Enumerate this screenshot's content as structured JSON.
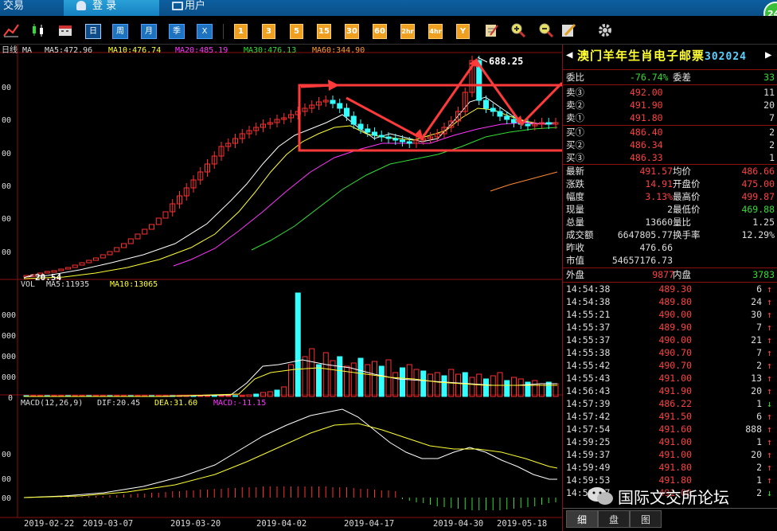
{
  "tabs": [
    {
      "label": "交易"
    },
    {
      "label": "登 录"
    },
    {
      "label": "用户"
    }
  ],
  "badge": "24",
  "toolbar": {
    "periods": [
      "日",
      "周",
      "月",
      "季",
      "X"
    ],
    "minutes": [
      "1",
      "3",
      "5",
      "15",
      "30",
      "60",
      "2hr",
      "4hr",
      "Y"
    ]
  },
  "chart": {
    "ma_label": "MA",
    "period_label": "日线",
    "ma5": "MA5:472.96",
    "ma10": "MA10:476.74",
    "ma20": "MA20:485.19",
    "ma30": "MA30:476.13",
    "ma60": "MA60:344.90",
    "high_label": "688.25",
    "low_label": "20.54",
    "vol_label": "VOL",
    "vol_ma5": "MA5:11935",
    "vol_ma10": "MA10:13065",
    "macd_label": "MACD(12,26,9)",
    "dif": "DIF:20.45",
    "dea": "DEA:31.60",
    "macd": "MACD:-11.15",
    "y_ticks_price": [
      "00",
      "00",
      "00",
      "00",
      "00",
      "00",
      "00"
    ],
    "y_ticks_vol": [
      "000",
      "000",
      "000",
      "000",
      "0"
    ],
    "y_ticks_macd": [
      "00",
      "00",
      "00"
    ],
    "dates": [
      "2019-02-22",
      "2019-03-07",
      "2019-03-20",
      "2019-04-02",
      "2019-04-17",
      "2019-04-30",
      "2019-05-18"
    ]
  },
  "quote": {
    "name": "澳门羊年生肖电子邮票",
    "code": "302024",
    "weibi_label": "委比",
    "weibi_value": "-76.74%",
    "weicha_label": "委差",
    "weicha_value": "33",
    "asks": [
      {
        "label": "卖③",
        "price": "492.00",
        "vol": "11"
      },
      {
        "label": "卖②",
        "price": "491.90",
        "vol": "20"
      },
      {
        "label": "卖①",
        "price": "491.80",
        "vol": "7"
      }
    ],
    "bids": [
      {
        "label": "买①",
        "price": "486.40",
        "vol": "2"
      },
      {
        "label": "买②",
        "price": "486.34",
        "vol": "2"
      },
      {
        "label": "买③",
        "price": "486.33",
        "vol": "1"
      }
    ],
    "stats": [
      {
        "l1": "最新",
        "v1": "491.57",
        "l2": "均价",
        "v2": "486.66",
        "c1": "red",
        "c2": "red"
      },
      {
        "l1": "涨跌",
        "v1": "14.91",
        "l2": "开盘价",
        "v2": "475.00",
        "c1": "red",
        "c2": "red"
      },
      {
        "l1": "幅度",
        "v1": "3.13%",
        "l2": "最高价",
        "v2": "499.87",
        "c1": "red",
        "c2": "red"
      },
      {
        "l1": "现量",
        "v1": "2",
        "l2": "最低价",
        "v2": "469.88",
        "c1": "white",
        "c2": "green"
      },
      {
        "l1": "总量",
        "v1": "13660",
        "l2": "量比",
        "v2": "1.25",
        "c1": "white",
        "c2": "white"
      },
      {
        "l1": "成交额",
        "v1": "6647805.77",
        "l2": "换手率",
        "v2": "12.29%",
        "c1": "white",
        "c2": "white"
      },
      {
        "l1": "昨收",
        "v1": "476.66",
        "l2": "",
        "v2": "",
        "c1": "white",
        "c2": "white"
      },
      {
        "l1": "市值",
        "v1": "54657176.73",
        "l2": "",
        "v2": "",
        "c1": "white",
        "c2": "white"
      }
    ],
    "waipan_label": "外盘",
    "waipan_value": "9877",
    "neipan_label": "内盘",
    "neipan_value": "3783",
    "ticks": [
      {
        "time": "14:54:38",
        "price": "489.30",
        "vol": "6",
        "dir": "↑",
        "pc": "red"
      },
      {
        "time": "14:54:38",
        "price": "489.80",
        "vol": "24",
        "dir": "↑",
        "pc": "red"
      },
      {
        "time": "14:55:21",
        "price": "490.00",
        "vol": "30",
        "dir": "↑",
        "pc": "red"
      },
      {
        "time": "14:55:37",
        "price": "489.90",
        "vol": "7",
        "dir": "↑",
        "pc": "red"
      },
      {
        "time": "14:55:37",
        "price": "490.00",
        "vol": "21",
        "dir": "↑",
        "pc": "red"
      },
      {
        "time": "14:55:38",
        "price": "490.70",
        "vol": "7",
        "dir": "↑",
        "pc": "red"
      },
      {
        "time": "14:55:42",
        "price": "490.70",
        "vol": "2",
        "dir": "↑",
        "pc": "red"
      },
      {
        "time": "14:55:43",
        "price": "491.00",
        "vol": "13",
        "dir": "↑",
        "pc": "red"
      },
      {
        "time": "14:56:43",
        "price": "491.90",
        "vol": "20",
        "dir": "↑",
        "pc": "red"
      },
      {
        "time": "14:57:39",
        "price": "486.22",
        "vol": "1",
        "dir": "↓",
        "pc": "red"
      },
      {
        "time": "14:57:42",
        "price": "491.50",
        "vol": "6",
        "dir": "↑",
        "pc": "red"
      },
      {
        "time": "14:57:54",
        "price": "491.60",
        "vol": "888",
        "dir": "↑",
        "pc": "red"
      },
      {
        "time": "14:59:25",
        "price": "491.00",
        "vol": "1",
        "dir": "↑",
        "pc": "red"
      },
      {
        "time": "14:59:37",
        "price": "491.00",
        "vol": "20",
        "dir": "↑",
        "pc": "red"
      },
      {
        "time": "14:59:49",
        "price": "491.80",
        "vol": "2",
        "dir": "↑",
        "pc": "red"
      },
      {
        "time": "14:59:53",
        "price": "491.80",
        "vol": "1",
        "dir": "↑",
        "pc": "red"
      },
      {
        "time": "14:59:57",
        "price": "491.00",
        "vol": "2",
        "dir": "↓",
        "pc": "red"
      }
    ],
    "bottom_tabs": [
      "细",
      "盘",
      "图"
    ]
  },
  "watermark": "国际文交所论坛",
  "colors": {
    "up": "#ff3030",
    "down": "#33ffff",
    "ma5": "#ffffff",
    "ma10": "#ffff33",
    "ma20": "#ff33ff",
    "ma30": "#33dd33",
    "annotation": "#ff3a3a"
  }
}
